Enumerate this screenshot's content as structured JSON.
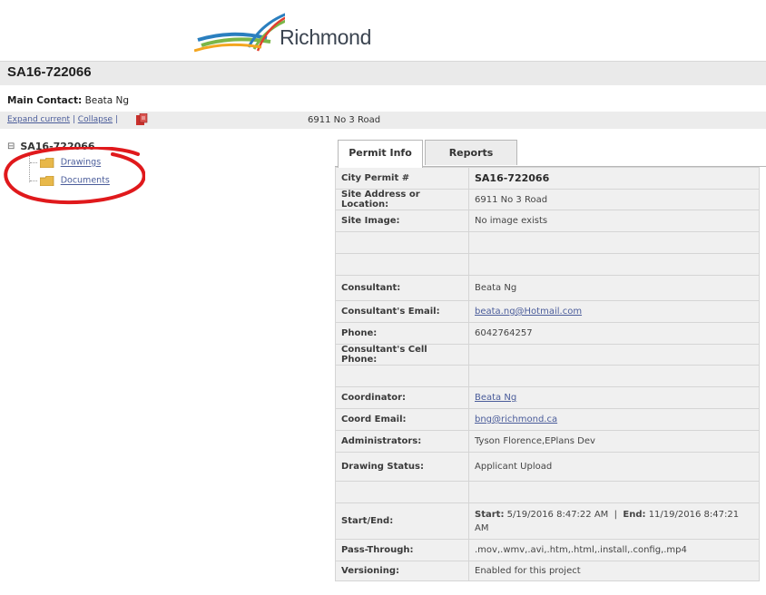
{
  "header": {
    "logo_text": "Richmond",
    "permit_title": "SA16-722066"
  },
  "main_contact": {
    "label": "Main Contact:",
    "value": "Beata Ng"
  },
  "toolbar": {
    "expand_label": "Expand current",
    "separator": "|",
    "collapse_label": "Collapse",
    "address": "6911 No 3 Road"
  },
  "tree": {
    "root_toggle": "⊟",
    "root_label": "SA16-722066",
    "children": [
      {
        "label": "Drawings"
      },
      {
        "label": "Documents"
      }
    ]
  },
  "tabs": [
    {
      "label": "Permit Info",
      "active": true
    },
    {
      "label": "Reports",
      "active": false
    }
  ],
  "permit_info": {
    "city_permit": {
      "label": "City Permit #",
      "value": "SA16-722066"
    },
    "site_address": {
      "label": "Site Address or Location:",
      "value": "6911 No 3 Road"
    },
    "site_image": {
      "label": "Site Image:",
      "value": "No image exists"
    },
    "consultant": {
      "label": "Consultant:",
      "value": "Beata Ng"
    },
    "consultant_email": {
      "label": "Consultant's Email:",
      "value": "beata.ng@Hotmail.com"
    },
    "phone": {
      "label": "Phone:",
      "value": "6042764257"
    },
    "consultant_cell": {
      "label": "Consultant's Cell Phone:",
      "value": ""
    },
    "coordinator": {
      "label": "Coordinator:",
      "value": "Beata Ng"
    },
    "coord_email": {
      "label": "Coord Email:",
      "value": "bng@richmond.ca"
    },
    "administrators": {
      "label": "Administrators:",
      "value": "Tyson Florence,EPlans Dev"
    },
    "drawing_status": {
      "label": "Drawing Status:",
      "value": "Applicant Upload"
    },
    "start_end": {
      "label": "Start/End:",
      "start_label": "Start:",
      "start_value": "5/19/2016 8:47:22 AM",
      "divider": "|",
      "end_label": "End:",
      "end_value": "11/19/2016 8:47:21 AM"
    },
    "pass_through": {
      "label": "Pass-Through:",
      "value": ".mov,.wmv,.avi,.htm,.html,.install,.config,.mp4"
    },
    "versioning": {
      "label": "Versioning:",
      "value": "Enabled for this project"
    }
  },
  "colors": {
    "link": "#4a5c9a",
    "highlight_circle": "#e0191c",
    "folder": "#e8b84a"
  }
}
